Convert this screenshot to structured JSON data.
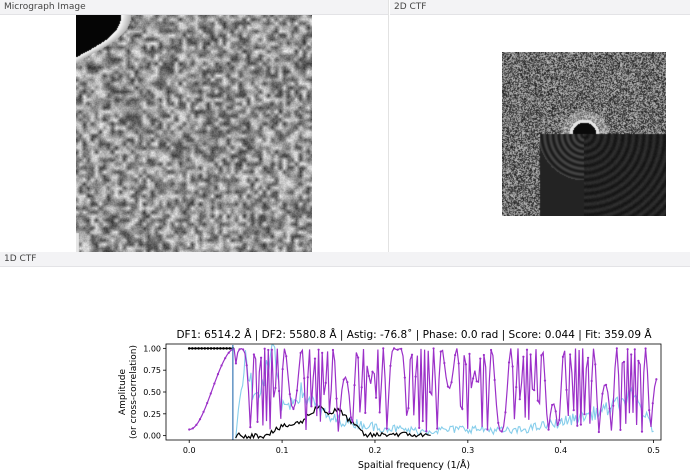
{
  "panels": {
    "micrograph": {
      "title": "Micrograph Image"
    },
    "ctf2d": {
      "title": "2D CTF"
    },
    "ctf1d": {
      "title": "1D CTF"
    }
  },
  "chart_data": {
    "type": "line",
    "title": "DF1: 6514.2 Å | DF2: 5580.8 Å | Astig: -76.8˚ | Phase: 0.0 rad | Score: 0.044 | Fit: 359.09 Å",
    "xlabel": "Spaitial frequency (1/Å)",
    "ylabel": [
      "Amplitude",
      "(or cross-correlation)"
    ],
    "xlim": [
      -0.025,
      0.508
    ],
    "ylim": [
      -0.05,
      1.05
    ],
    "xticks": [
      "0.0",
      "0.1",
      "0.2",
      "0.3",
      "0.4",
      "0.5"
    ],
    "xtick_values": [
      0.0,
      0.1,
      0.2,
      0.3,
      0.4,
      0.5
    ],
    "yticks": [
      "0.00",
      "0.25",
      "0.50",
      "0.75",
      "1.00"
    ],
    "ytick_values": [
      0.0,
      0.25,
      0.5,
      0.75,
      1.0
    ],
    "grid": false,
    "legend": "none",
    "colors": {
      "fit_ctf": "#9b30c8",
      "spectrum": "#87ceeb",
      "cross_correlation": "#000000",
      "cutoff": "#3a78b5"
    },
    "cutoff_x": 0.047,
    "fit_x_end": 0.503,
    "series": [
      {
        "role": "fit_ctf",
        "x": [
          0.0,
          0.01,
          0.02,
          0.03,
          0.04,
          0.05,
          0.06,
          0.065,
          0.07,
          0.08,
          0.09,
          0.1,
          0.11,
          0.12,
          0.13,
          0.14,
          0.15,
          0.16,
          0.17,
          0.18,
          0.2,
          0.25,
          0.3,
          0.35,
          0.4,
          0.45,
          0.5
        ],
        "y": [
          0.07,
          0.1,
          0.25,
          0.5,
          0.8,
          1.0,
          0.9,
          0.6,
          0.2,
          0.15,
          1.0,
          0.1,
          0.9,
          0.05,
          1.0,
          0.1,
          0.98,
          0.1,
          1.0,
          0.08,
          1.0,
          0.05,
          1.0,
          0.08,
          0.95,
          0.06,
          0.8
        ]
      },
      {
        "role": "spectrum",
        "x": [
          0.05,
          0.06,
          0.07,
          0.08,
          0.09,
          0.1,
          0.12,
          0.15,
          0.2,
          0.25,
          0.3,
          0.35,
          0.4,
          0.45,
          0.48,
          0.5
        ],
        "y": [
          0.0,
          0.95,
          0.4,
          0.6,
          0.98,
          0.3,
          0.5,
          0.2,
          0.1,
          0.05,
          0.08,
          0.05,
          0.15,
          0.3,
          0.45,
          0.05
        ]
      },
      {
        "role": "cross_correlation",
        "x": [
          0.0,
          0.047,
          0.05,
          0.08,
          0.1,
          0.12,
          0.14,
          0.15,
          0.16,
          0.17,
          0.18,
          0.19,
          0.22,
          0.26
        ],
        "y": [
          1.0,
          1.0,
          0.0,
          0.0,
          0.1,
          0.15,
          0.35,
          0.25,
          0.3,
          0.2,
          0.1,
          0.0,
          0.02,
          0.0
        ]
      }
    ]
  }
}
